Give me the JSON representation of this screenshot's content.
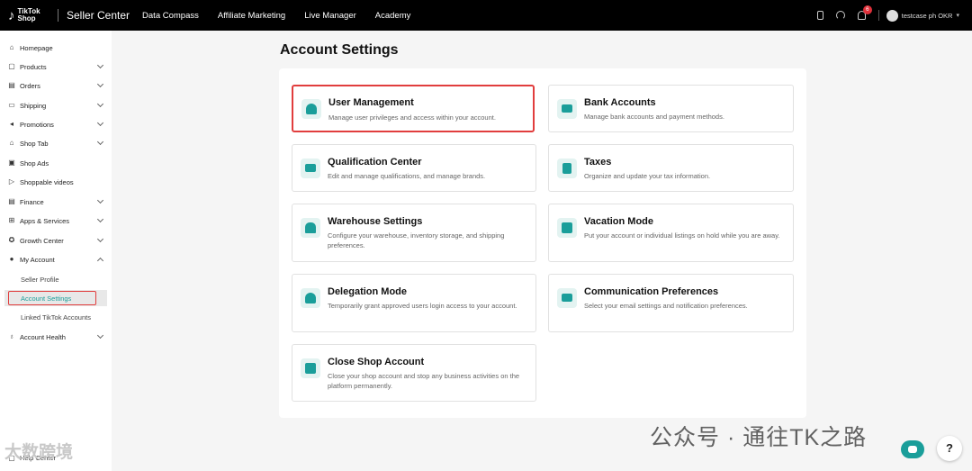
{
  "topbar": {
    "logo_mark": "♪",
    "logo_line1": "TikTok",
    "logo_line2": "Shop",
    "brand": "Seller Center",
    "nav": [
      "Data Compass",
      "Affiliate Marketing",
      "Live Manager",
      "Academy"
    ],
    "notification_count": "6",
    "user_name": "testcase ph OKR",
    "icons": [
      "phone-icon",
      "headset-icon",
      "bell-icon",
      "avatar",
      "chevron-down-icon"
    ]
  },
  "sidebar": {
    "items": [
      {
        "label": "Homepage",
        "icon": "home-icon",
        "chevron": false
      },
      {
        "label": "Products",
        "icon": "products-icon",
        "chevron": true
      },
      {
        "label": "Orders",
        "icon": "orders-icon",
        "chevron": true
      },
      {
        "label": "Shipping",
        "icon": "shipping-icon",
        "chevron": true
      },
      {
        "label": "Promotions",
        "icon": "megaphone-icon",
        "chevron": true
      },
      {
        "label": "Shop Tab",
        "icon": "shop-icon",
        "chevron": true
      },
      {
        "label": "Shop Ads",
        "icon": "ads-icon",
        "chevron": false
      },
      {
        "label": "Shoppable videos",
        "icon": "video-icon",
        "chevron": false
      },
      {
        "label": "Finance",
        "icon": "finance-icon",
        "chevron": true
      },
      {
        "label": "Apps & Services",
        "icon": "apps-icon",
        "chevron": true
      },
      {
        "label": "Growth Center",
        "icon": "growth-icon",
        "chevron": true
      },
      {
        "label": "My Account",
        "icon": "user-icon",
        "chevron": "up"
      }
    ],
    "sub_items": [
      "Seller Profile",
      "Account Settings",
      "Linked TikTok Accounts"
    ],
    "after": {
      "label": "Account Health",
      "icon": "trophy-icon"
    },
    "help": "Help Center"
  },
  "main": {
    "title": "Account Settings",
    "cards": [
      {
        "title": "User Management",
        "desc": "Manage user privileges and access within your account.",
        "icon": "user-icon"
      },
      {
        "title": "Bank Accounts",
        "desc": "Manage bank accounts and payment methods.",
        "icon": "card-icon"
      },
      {
        "title": "Qualification Center",
        "desc": "Edit and manage qualifications, and manage brands.",
        "icon": "id-card-icon"
      },
      {
        "title": "Taxes",
        "desc": "Organize and update your tax information.",
        "icon": "tax-icon"
      },
      {
        "title": "Warehouse Settings",
        "desc": "Configure your warehouse, inventory storage, and shipping preferences.",
        "icon": "warehouse-icon"
      },
      {
        "title": "Vacation Mode",
        "desc": "Put your account or individual listings on hold while you are away.",
        "icon": "calendar-clock-icon"
      },
      {
        "title": "Delegation Mode",
        "desc": "Temporarily grant approved users login access to your account.",
        "icon": "user-check-icon"
      },
      {
        "title": "Communication Preferences",
        "desc": "Select your email settings and notification preferences.",
        "icon": "mail-icon"
      },
      {
        "title": "Close Shop Account",
        "desc": "Close your shop account and stop any business activities on the platform permanently.",
        "icon": "store-close-icon"
      }
    ]
  },
  "overlay": {
    "watermark": "公众号 · 通往TK之路",
    "corner_logo": "大数跨境",
    "help_btn": "?"
  },
  "colors": {
    "accent": "#1a9e9a",
    "highlight": "#e13d3d"
  }
}
